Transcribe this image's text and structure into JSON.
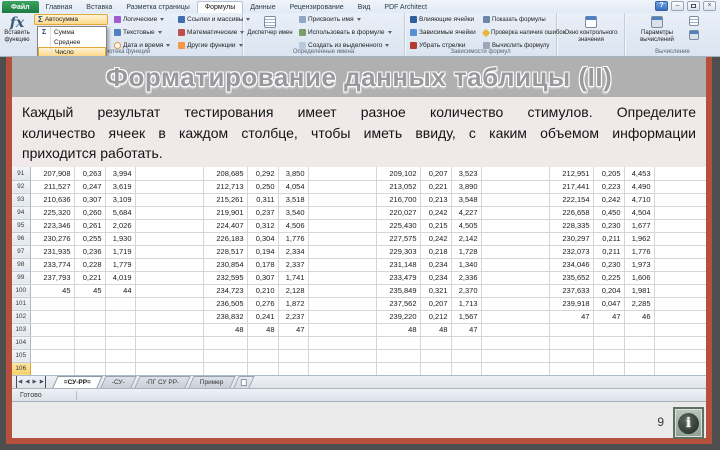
{
  "ribbon": {
    "file_tab": "Файл",
    "tabs": [
      {
        "label": "Главная"
      },
      {
        "label": "Вставка"
      },
      {
        "label": "Разметка страницы"
      },
      {
        "label": "Формулы",
        "active": true
      },
      {
        "label": "Данные"
      },
      {
        "label": "Рецензирование"
      },
      {
        "label": "Вид"
      },
      {
        "label": "PDF Architect"
      }
    ],
    "window": {
      "help": "?",
      "minimize": "–",
      "close": "×"
    },
    "icons": {
      "fx": "fx",
      "sigma": "Σ"
    },
    "function_library": {
      "label": "Библиотека функций",
      "insert_function": "Вставить функцию",
      "autosum": "Автосумма",
      "autosum_menu": [
        {
          "label": "Сумма",
          "icon_glyph": "Σ"
        },
        {
          "label": "Среднее",
          "icon_glyph": ""
        },
        {
          "label": "Число",
          "icon_glyph": "",
          "highlighted": true
        }
      ],
      "col_b": [
        {
          "label": "Логические",
          "icon": "logical"
        },
        {
          "label": "Текстовые",
          "icon": "text"
        },
        {
          "label": "Дата и время",
          "icon": "datetime"
        }
      ],
      "col_c": [
        {
          "label": "Ссылки и массивы",
          "icon": "lookup"
        },
        {
          "label": "Математические",
          "icon": "math"
        },
        {
          "label": "Другие функции",
          "icon": "more"
        }
      ]
    },
    "defined_names": {
      "label": "Определенные имена",
      "manager": "Диспетчер имен",
      "items": [
        {
          "label": "Присвоить имя",
          "icon": "name-tag"
        },
        {
          "label": "Использовать в формуле",
          "icon": "use-in-formula"
        },
        {
          "label": "Создать из выделенного",
          "icon": "create-from-selection"
        }
      ]
    },
    "formula_auditing": {
      "label": "Зависимости формул",
      "col_a": [
        {
          "label": "Влияющие ячейки",
          "icon": "trace-precedents"
        },
        {
          "label": "Зависимые ячейки",
          "icon": "trace-dependents"
        },
        {
          "label": "Убрать стрелки",
          "icon": "remove-arrows"
        }
      ],
      "col_b": [
        {
          "label": "Показать формулы",
          "icon": "show-formulas"
        },
        {
          "label": "Проверка наличия ошибок",
          "icon": "error-check"
        },
        {
          "label": "Вычислить формулу",
          "icon": "evaluate"
        }
      ]
    },
    "watch_window": {
      "label": "Окно контрольного значения"
    },
    "calculation": {
      "label": "Вычисление",
      "button": "Параметры вычислений"
    }
  },
  "slide": {
    "title": "Форматирование данных таблицы (II)",
    "body_lines": [
      "Каждый результат тестирования имеет разное количество стимулов. Определите",
      "количество ячеек в каждом столбце, чтобы иметь ввиду, с каким объемом информации",
      "приходится работать."
    ],
    "page_number": "9",
    "accent_frame_color": "#b5503c"
  },
  "spreadsheet": {
    "rows": [
      {
        "n": "91",
        "c": [
          "207,908",
          "0,263",
          "3,994",
          "",
          "208,685",
          "0,292",
          "3,850",
          "",
          "209,102",
          "0,207",
          "3,523",
          "",
          "212,951",
          "0,205",
          "4,453"
        ]
      },
      {
        "n": "92",
        "c": [
          "211,527",
          "0,247",
          "3,619",
          "",
          "212,713",
          "0,250",
          "4,054",
          "",
          "213,052",
          "0,221",
          "3,890",
          "",
          "217,441",
          "0,223",
          "4,490"
        ]
      },
      {
        "n": "93",
        "c": [
          "210,636",
          "0,307",
          "3,109",
          "",
          "215,261",
          "0,311",
          "3,518",
          "",
          "216,700",
          "0,213",
          "3,548",
          "",
          "222,154",
          "0,242",
          "4,710"
        ]
      },
      {
        "n": "94",
        "c": [
          "225,320",
          "0,260",
          "5,684",
          "",
          "219,901",
          "0,237",
          "3,540",
          "",
          "220,027",
          "0,242",
          "4,227",
          "",
          "226,658",
          "0,450",
          "4,504"
        ]
      },
      {
        "n": "95",
        "c": [
          "223,346",
          "0,261",
          "2,026",
          "",
          "224,407",
          "0,312",
          "4,506",
          "",
          "225,430",
          "0,215",
          "4,505",
          "",
          "228,335",
          "0,230",
          "1,677"
        ]
      },
      {
        "n": "96",
        "c": [
          "230,276",
          "0,255",
          "1,930",
          "",
          "226,183",
          "0,304",
          "1,776",
          "",
          "227,575",
          "0,242",
          "2,142",
          "",
          "230,297",
          "0,211",
          "1,962"
        ]
      },
      {
        "n": "97",
        "c": [
          "231,935",
          "0,236",
          "1,719",
          "",
          "228,517",
          "0,194",
          "2,334",
          "",
          "229,303",
          "0,218",
          "1,728",
          "",
          "232,073",
          "0,211",
          "1,776"
        ]
      },
      {
        "n": "98",
        "c": [
          "233,774",
          "0,228",
          "1,779",
          "",
          "230,854",
          "0,178",
          "2,337",
          "",
          "231,148",
          "0,234",
          "1,340",
          "",
          "234,046",
          "0,230",
          "1,973"
        ]
      },
      {
        "n": "99",
        "c": [
          "237,793",
          "0,221",
          "4,019",
          "",
          "232,595",
          "0,307",
          "1,741",
          "",
          "233,479",
          "0,234",
          "2,336",
          "",
          "235,652",
          "0,225",
          "1,606"
        ]
      },
      {
        "n": "100",
        "c": [
          "45",
          "45",
          "44",
          "",
          "234,723",
          "0,210",
          "2,128",
          "",
          "235,849",
          "0,321",
          "2,370",
          "",
          "237,633",
          "0,204",
          "1,981"
        ]
      },
      {
        "n": "101",
        "c": [
          "",
          "",
          "",
          "",
          "236,505",
          "0,276",
          "1,872",
          "",
          "237,562",
          "0,207",
          "1,713",
          "",
          "239,918",
          "0,047",
          "2,285"
        ]
      },
      {
        "n": "102",
        "c": [
          "",
          "",
          "",
          "",
          "238,832",
          "0,241",
          "2,237",
          "",
          "239,220",
          "0,212",
          "1,567",
          "",
          "47",
          "47",
          "46"
        ]
      },
      {
        "n": "103",
        "c": [
          "",
          "",
          "",
          "",
          "48",
          "48",
          "47",
          "",
          "48",
          "48",
          "47",
          "",
          "",
          "",
          ""
        ]
      },
      {
        "n": "104",
        "c": [
          "",
          "",
          "",
          "",
          "",
          "",
          "",
          "",
          "",
          "",
          "",
          "",
          "",
          "",
          ""
        ]
      },
      {
        "n": "105",
        "c": [
          "",
          "",
          "",
          "",
          "",
          "",
          "",
          "",
          "",
          "",
          "",
          "",
          "",
          "",
          ""
        ]
      },
      {
        "n": "106",
        "c": [
          "",
          "",
          "",
          "",
          "",
          "",
          "",
          "",
          "",
          "",
          "",
          "",
          "",
          "",
          ""
        ],
        "selected": true
      }
    ]
  },
  "sheet_tabs": {
    "nav": {
      "first": "◀",
      "prev": "◀",
      "next": "▶",
      "last": "▶"
    },
    "tabs": [
      {
        "label": "=СУ-РР=",
        "active": true
      },
      {
        "label": "-СУ-"
      },
      {
        "label": "-ПГ СУ РР-"
      },
      {
        "label": "Пример"
      }
    ]
  },
  "status_bar": {
    "text": "Готово"
  }
}
